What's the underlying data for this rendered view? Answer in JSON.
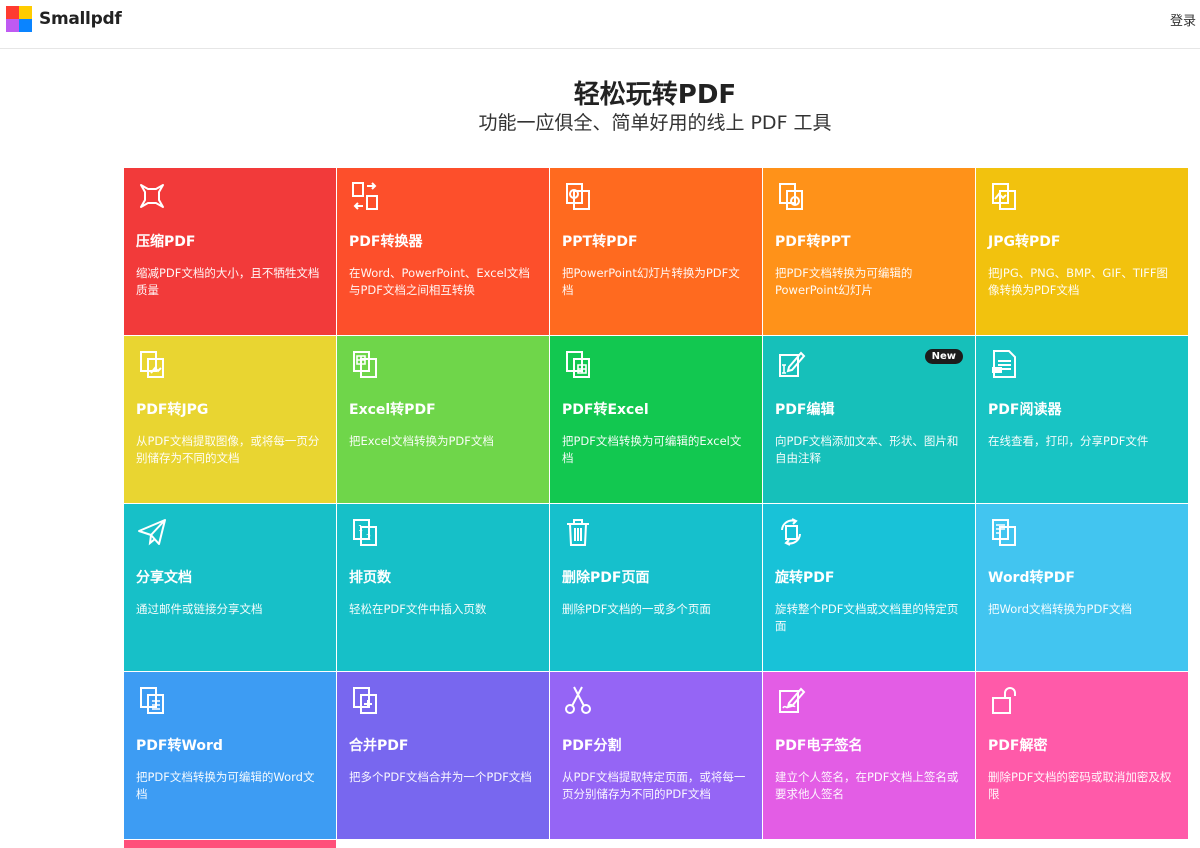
{
  "header": {
    "brand": "Smallpdf",
    "login": "登录"
  },
  "hero": {
    "title": "轻松玩转PDF",
    "subtitle": "功能一应俱全、简单好用的线上 PDF 工具"
  },
  "tools": [
    {
      "name": "压缩PDF",
      "desc": "缩减PDF文档的大小，且不牺牲文档质量",
      "color": "#f23a3a",
      "icon": "compress-icon"
    },
    {
      "name": "PDF转换器",
      "desc": "在Word、PowerPoint、Excel文档与PDF文档之间相互转换",
      "color": "#fd4f2b",
      "icon": "converter-icon"
    },
    {
      "name": "PPT转PDF",
      "desc": "把PowerPoint幻灯片转换为PDF文档",
      "color": "#ff6a1f",
      "icon": "ppt-to-pdf-icon"
    },
    {
      "name": "PDF转PPT",
      "desc": "把PDF文档转换为可编辑的PowerPoint幻灯片",
      "color": "#ff9219",
      "icon": "pdf-to-ppt-icon"
    },
    {
      "name": "JPG转PDF",
      "desc": "把JPG、PNG、BMP、GIF、TIFF图像转换为PDF文档",
      "color": "#f2c20e",
      "icon": "jpg-to-pdf-icon"
    },
    {
      "name": "PDF转JPG",
      "desc": "从PDF文档提取图像，或将每一页分别储存为不同的文档",
      "color": "#e9d531",
      "icon": "pdf-to-jpg-icon"
    },
    {
      "name": "Excel转PDF",
      "desc": "把Excel文档转换为PDF文档",
      "color": "#6fd64a",
      "icon": "excel-to-pdf-icon"
    },
    {
      "name": "PDF转Excel",
      "desc": "把PDF文档转换为可编辑的Excel文档",
      "color": "#12c850",
      "icon": "pdf-to-excel-icon"
    },
    {
      "name": "PDF编辑",
      "desc": "向PDF文档添加文本、形状、图片和自由注释",
      "color": "#16c0ba",
      "icon": "edit-icon",
      "badge": "New"
    },
    {
      "name": "PDF阅读器",
      "desc": "在线查看，打印，分享PDF文件",
      "color": "#18c4c4",
      "icon": "reader-icon"
    },
    {
      "name": "分享文档",
      "desc": "通过邮件或链接分享文档",
      "color": "#17c0c8",
      "icon": "share-icon"
    },
    {
      "name": "排页数",
      "desc": "轻松在PDF文件中插入页数",
      "color": "#16c0c8",
      "icon": "page-number-icon"
    },
    {
      "name": "删除PDF页面",
      "desc": "删除PDF文档的一或多个页面",
      "color": "#16c0cc",
      "icon": "trash-icon"
    },
    {
      "name": "旋转PDF",
      "desc": "旋转整个PDF文档或文档里的特定页面",
      "color": "#18c2d8",
      "icon": "rotate-icon"
    },
    {
      "name": "Word转PDF",
      "desc": "把Word文档转换为PDF文档",
      "color": "#42c5f0",
      "icon": "word-to-pdf-icon"
    },
    {
      "name": "PDF转Word",
      "desc": "把PDF文档转换为可编辑的Word文档",
      "color": "#3d9cf3",
      "icon": "pdf-to-word-icon"
    },
    {
      "name": "合并PDF",
      "desc": "把多个PDF文档合并为一个PDF文档",
      "color": "#7867ef",
      "icon": "merge-icon"
    },
    {
      "name": "PDF分割",
      "desc": "从PDF文档提取特定页面，或将每一页分别储存为不同的PDF文档",
      "color": "#9565f5",
      "icon": "scissors-icon"
    },
    {
      "name": "PDF电子签名",
      "desc": "建立个人签名，在PDF文档上签名或要求他人签名",
      "color": "#e35de5",
      "icon": "signature-icon"
    },
    {
      "name": "PDF解密",
      "desc": "删除PDF文档的密码或取消加密及权限",
      "color": "#ff5aa9",
      "icon": "unlock-icon"
    }
  ],
  "partial_tile_color": "#ff4f7a"
}
